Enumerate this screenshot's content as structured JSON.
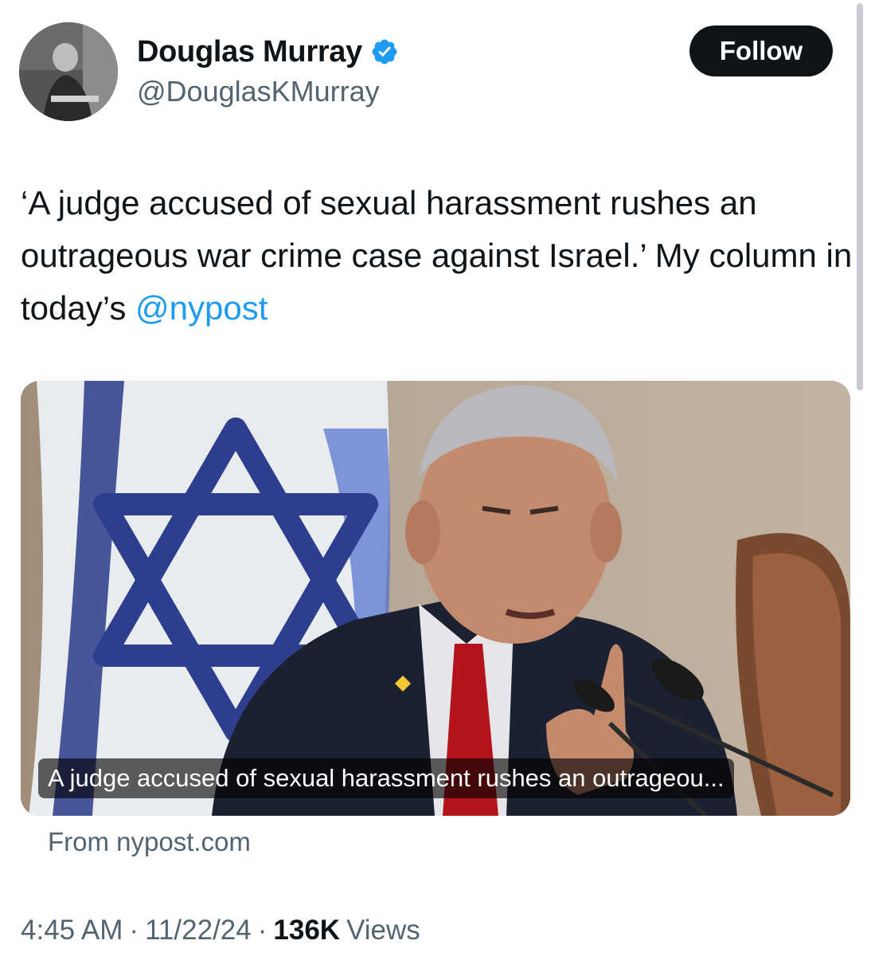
{
  "author": {
    "display_name": "Douglas Murray",
    "handle": "@DouglasKMurray",
    "verified_icon": "verified-badge-icon",
    "verified_color": "#1d9bf0"
  },
  "follow_button": {
    "label": "Follow"
  },
  "tweet": {
    "text_before": "‘A judge accused of sexual harassment rushes an outrageous war crime case against Israel.’ My column in today’s ",
    "mention": "@nypost"
  },
  "link_card": {
    "caption": "A judge accused of sexual harassment rushes an outrageou...",
    "source": "From nypost.com"
  },
  "meta": {
    "time": "4:45 AM",
    "separator": "·",
    "date": "11/22/24",
    "views_count": "136K",
    "views_label": "Views"
  },
  "colors": {
    "accent": "#1d9bf0",
    "text_primary": "#0f1419",
    "text_secondary": "#536471"
  }
}
